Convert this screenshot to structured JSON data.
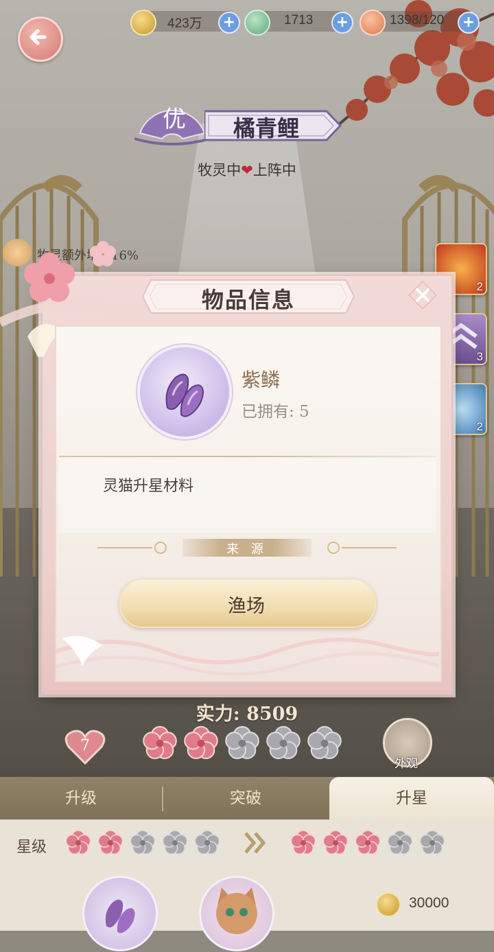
{
  "resources": {
    "paw_coins": "423万",
    "jade": "1713",
    "stamina": "1398/120"
  },
  "character": {
    "rank": "优",
    "name": "橘青鲤",
    "status_left": "牧灵中",
    "status_right": "上阵中",
    "bonus": "牧灵额外增加16%"
  },
  "skills": [
    {
      "icon": "fire-spirit-icon",
      "count": "2"
    },
    {
      "icon": "chevron-rank-icon",
      "count": "3"
    },
    {
      "icon": "ice-spirit-icon",
      "count": "2"
    }
  ],
  "dialog": {
    "title": "物品信息",
    "item_name": "紫鳞",
    "owned_label": "已拥有",
    "owned_count": "5",
    "description": "灵猫升星材料",
    "source_label": "来 源",
    "source_button": "渔场"
  },
  "power": {
    "label": "实力",
    "value": "8509"
  },
  "affection_level": "7",
  "current_stars": {
    "filled": 2,
    "total": 5
  },
  "appearance_label": "外观",
  "tabs": [
    {
      "label": "升级",
      "active": false
    },
    {
      "label": "突破",
      "active": false
    },
    {
      "label": "升星",
      "active": true
    }
  ],
  "star_panel": {
    "label": "星级",
    "from_filled": 2,
    "to_filled": 3,
    "total": 5,
    "cost": "30000"
  },
  "colors": {
    "star_filled": "#e07c8a",
    "star_empty": "#a9a9ad",
    "accent_purple": "#8a6fb5"
  }
}
